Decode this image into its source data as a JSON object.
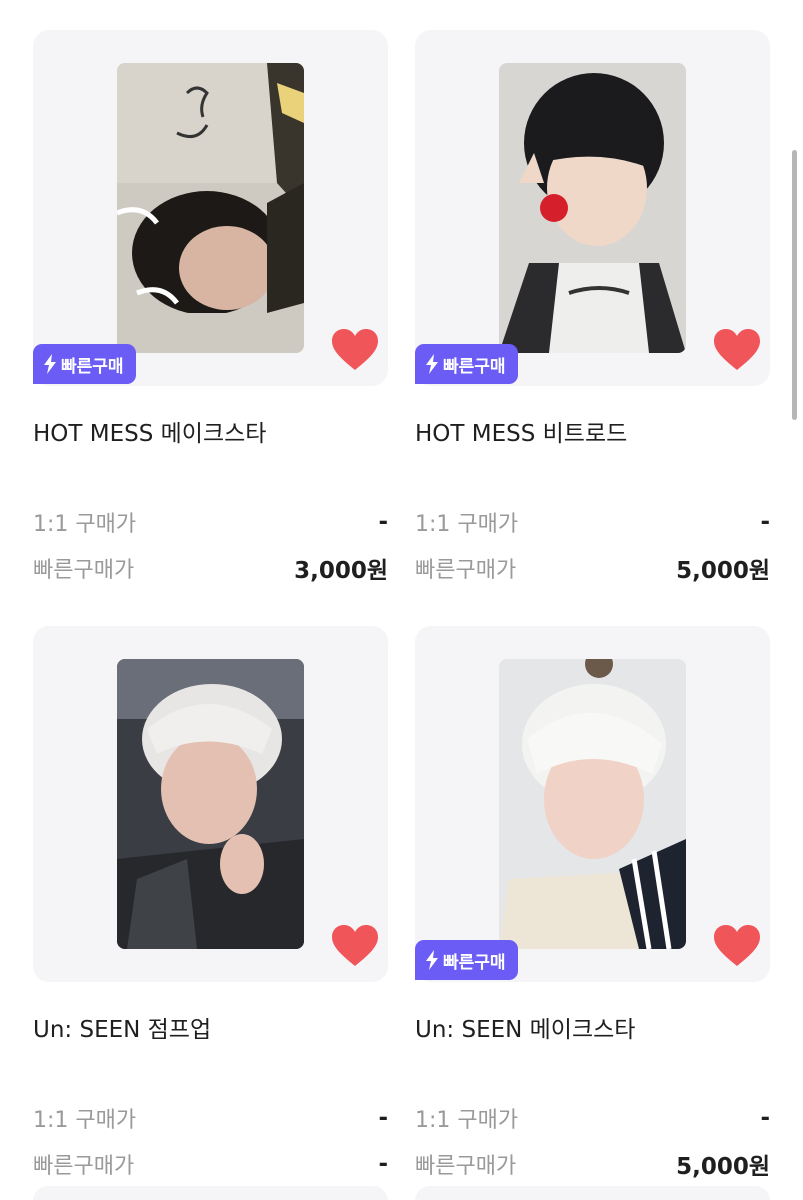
{
  "colors": {
    "badge_bg": "#6a5cf5",
    "heart": "#f0555a",
    "thumb_bg": "#f5f5f7",
    "label_gray": "#9a9a9a"
  },
  "products": [
    {
      "title": "HOT MESS 메이크스타",
      "quick_buy_badge": "빠른구매",
      "has_badge": true,
      "price_1to1_label": "1:1 구매가",
      "price_1to1_value": "-",
      "price_quick_label": "빠른구매가",
      "price_quick_value": "3,000원",
      "icon": "heart-icon",
      "liked": true
    },
    {
      "title": "HOT MESS 비트로드",
      "quick_buy_badge": "빠른구매",
      "has_badge": true,
      "price_1to1_label": "1:1 구매가",
      "price_1to1_value": "-",
      "price_quick_label": "빠른구매가",
      "price_quick_value": "5,000원",
      "icon": "heart-icon",
      "liked": true
    },
    {
      "title": "Un: SEEN 점프업",
      "quick_buy_badge": "",
      "has_badge": false,
      "price_1to1_label": "1:1 구매가",
      "price_1to1_value": "-",
      "price_quick_label": "빠른구매가",
      "price_quick_value": "-",
      "icon": "heart-icon",
      "liked": true
    },
    {
      "title": "Un: SEEN 메이크스타",
      "quick_buy_badge": "빠른구매",
      "has_badge": true,
      "price_1to1_label": "1:1 구매가",
      "price_1to1_value": "-",
      "price_quick_label": "빠른구매가",
      "price_quick_value": "5,000원",
      "icon": "heart-icon",
      "liked": true
    }
  ]
}
